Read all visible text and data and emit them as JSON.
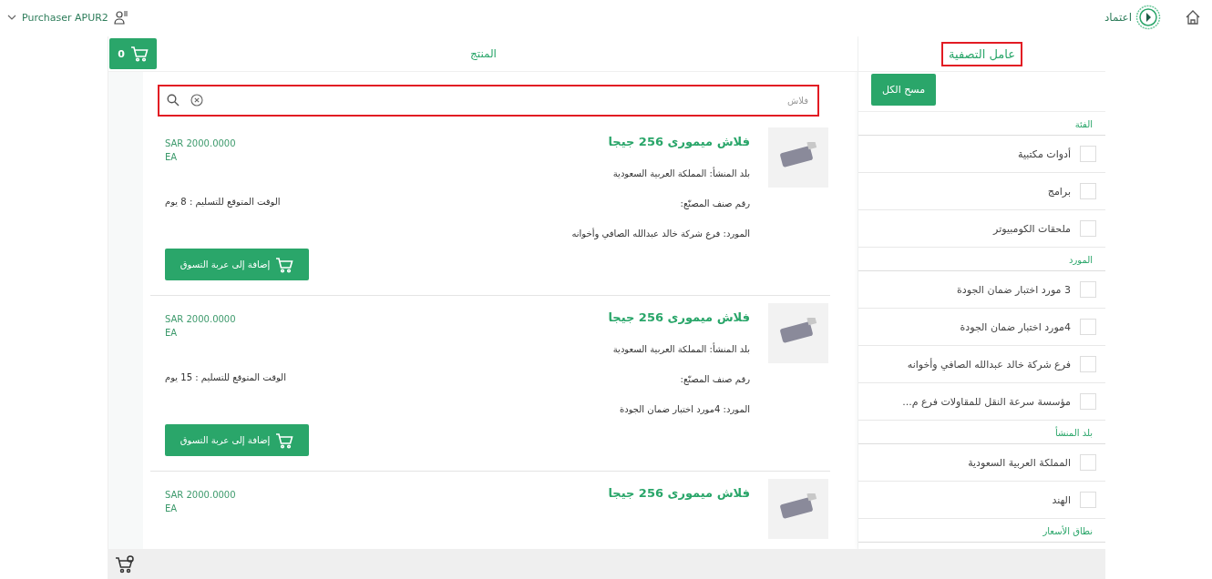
{
  "topbar": {
    "user": "Purchaser APUR2",
    "logo_text": "اعتماد"
  },
  "product_panel": {
    "title": "المنتج",
    "cart_count": "0",
    "search": {
      "value": "فلاش",
      "highlighted": true
    },
    "products": [
      {
        "name": "فلاش ميمورى 256 جيجا",
        "price": "SAR 2000.0000",
        "unit": "EA",
        "details": [
          "بلد المنشأ: المملكة العربية السعودية",
          "رقم صنف المصنّع:",
          "المورد: فرع شركة خالد عبدالله الصافي وأخوانه"
        ],
        "delivery": "الوقت المتوقع للتسليم : 8 يوم",
        "button": "إضافة إلى عربة التسوق"
      },
      {
        "name": "فلاش ميمورى 256 جيجا",
        "price": "SAR 2000.0000",
        "unit": "EA",
        "details": [
          "بلد المنشأ: المملكة العربية السعودية",
          "رقم صنف المصنّع:",
          "المورد: 4مورد اختبار ضمان الجودة"
        ],
        "delivery": "الوقت المتوقع للتسليم : 15 يوم",
        "button": "إضافة إلى عربة التسوق"
      },
      {
        "name": "فلاش ميمورى 256 جيجا",
        "price": "SAR 2000.0000",
        "unit": "EA"
      }
    ]
  },
  "filter_panel": {
    "title": "عامل التصفية",
    "highlighted": true,
    "clear_button": "مسح الكل",
    "groups": [
      {
        "title": "الفئة",
        "items": [
          {
            "label": "أدوات مكتبية",
            "checked": false
          },
          {
            "label": "برامج",
            "checked": false
          },
          {
            "label": "ملحقات الكومبيوتر",
            "checked": false
          }
        ]
      },
      {
        "title": "المورد",
        "items": [
          {
            "label": "3 مورد اختبار ضمان الجودة",
            "checked": false
          },
          {
            "label": "4مورد اختبار ضمان الجودة",
            "checked": false
          },
          {
            "label": "فرع شركة خالد عبدالله الصافي وأخوانه",
            "checked": false
          },
          {
            "label": "مؤسسة سرعة النقل للمقاولات فرع م...",
            "checked": false
          }
        ]
      },
      {
        "title": "بلد المنشأ",
        "items": [
          {
            "label": "المملكة العربية السعودية",
            "checked": false
          },
          {
            "label": "الهند",
            "checked": false
          }
        ]
      },
      {
        "title": "نطاق الأسعار"
      }
    ]
  }
}
